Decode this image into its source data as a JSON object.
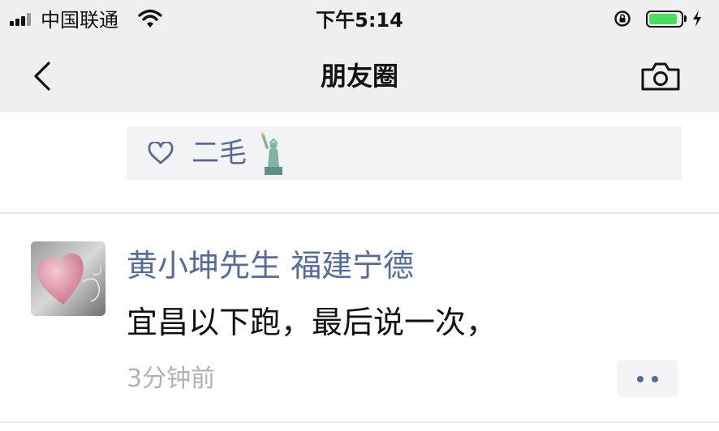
{
  "status_bar": {
    "carrier": "中国联通",
    "time": "下午5:14",
    "battery_level": 0.9
  },
  "nav": {
    "title": "朋友圈"
  },
  "likes": {
    "names": "二毛"
  },
  "post": {
    "author": "黄小坤先生 福建宁德",
    "text": "宜昌以下跑，最后说一次，",
    "time": "3分钟前"
  },
  "colors": {
    "link": "#576b95",
    "header_bg": "#efefef",
    "battery": "#4cd964",
    "timestamp": "#b2b2b2"
  },
  "icons": {
    "back": "chevron-left-icon",
    "camera": "camera-icon",
    "like": "heart-outline-icon",
    "more": "more-dots-icon",
    "emoji": "statue-of-liberty-emoji"
  }
}
